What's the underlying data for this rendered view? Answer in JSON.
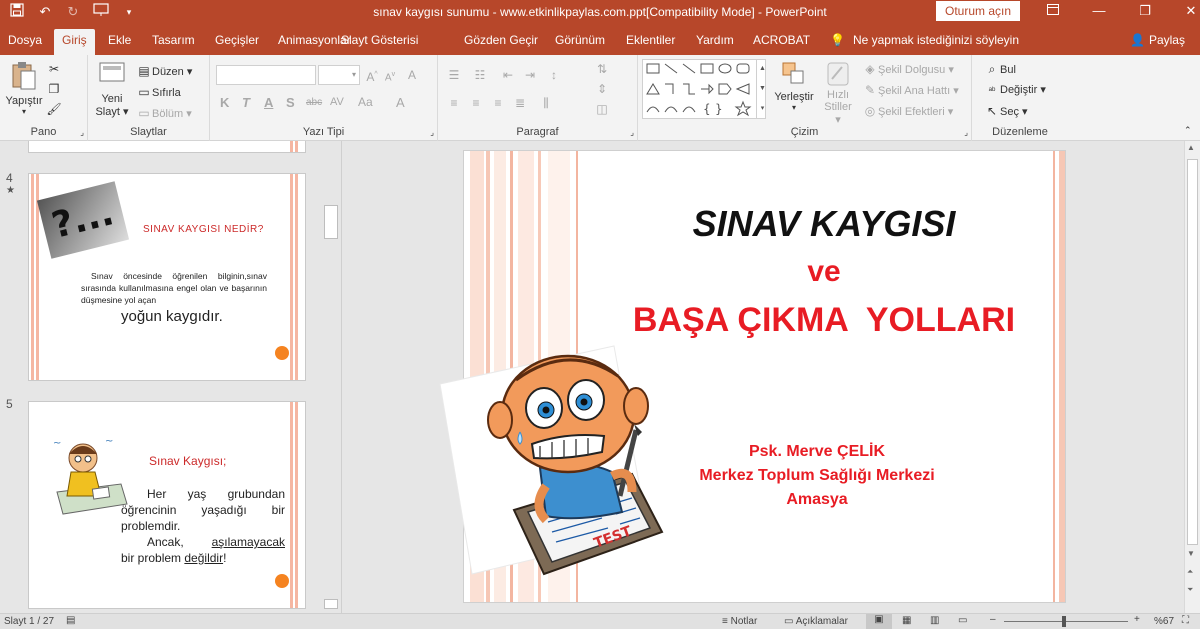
{
  "titlebar": {
    "save_icon": "save-icon",
    "undo_icon": "undo-icon",
    "redo_icon": "redo-icon",
    "present_icon": "present-from-start-icon",
    "title": "sınav kaygısı sunumu - www.etkinlikpaylas.com.ppt[Compatibility Mode]  -  PowerPoint",
    "signin": "Oturum açın"
  },
  "tabs": {
    "items": [
      "Dosya",
      "Giriş",
      "Ekle",
      "Tasarım",
      "Geçişler",
      "Animasyonlar",
      "Slayt Gösterisi",
      "Gözden Geçir",
      "Görünüm",
      "Eklentiler",
      "Yardım",
      "ACROBAT"
    ],
    "tell_me": "Ne yapmak istediğinizi söyleyin",
    "share": "Paylaş"
  },
  "ribbon": {
    "pano": {
      "paste": "Yapıştır",
      "label": "Pano"
    },
    "slaytlar": {
      "new_slide_1": "Yeni",
      "new_slide_2": "Slayt",
      "layout": "Düzen",
      "reset": "Sıfırla",
      "section": "Bölüm",
      "label": "Slaytlar"
    },
    "yazi_tipi": {
      "bold": "K",
      "italic": "T",
      "underline": "A",
      "strike": "S",
      "shadow": "abc",
      "spacing": "AV",
      "case": "Aa",
      "label": "Yazı Tipi"
    },
    "paragraf": {
      "label": "Paragraf"
    },
    "cizim": {
      "arrange": "Yerleştir",
      "quick_styles_1": "Hızlı",
      "quick_styles_2": "Stiller",
      "fill": "Şekil Dolgusu",
      "outline": "Şekil Ana Hattı",
      "effects": "Şekil Efektleri",
      "label": "Çizim"
    },
    "duzenleme": {
      "find": "Bul",
      "replace": "Değiştir",
      "select": "Seç",
      "label": "Düzenleme"
    }
  },
  "thumbnails": {
    "slide4": {
      "number": "4",
      "star": "★",
      "question": "?...",
      "heading": "SINAV KAYGISI NEDİR?",
      "body": "Sınav öncesinde öğrenilen bilginin,sınav sırasında kullanılmasına engel olan ve başarının düşmesine yol açan",
      "emphasis": "yoğun kaygıdır",
      "period": "."
    },
    "slide5": {
      "number": "5",
      "heading": "Sınav Kaygısı;",
      "line1": "Her yaş grubundan öğrencinin yaşadığı bir problemdir.",
      "line2a": "Ancak,",
      "line2b": "aşılamayacak",
      "line3a": "bir problem",
      "line3b": "değildir",
      "line3c": "!"
    }
  },
  "slide": {
    "title": "SINAV KAYGISI",
    "and": "ve",
    "subtitle": "BAŞA ÇIKMA  YOLLARI",
    "author": "Psk. Merve ÇELİK",
    "org": "Merkez Toplum Sağlığı Merkezi",
    "city": "Amasya",
    "test_label": "TEST"
  },
  "status": {
    "slide_count": "Slayt 1 / 27",
    "notes": "Notlar",
    "comments": "Açıklamalar",
    "zoom": "%67"
  },
  "colors": {
    "accent": "#b7472a",
    "slide_red": "#e81c24",
    "thumb_red": "#cc2a2a",
    "orange": "#f58320"
  }
}
